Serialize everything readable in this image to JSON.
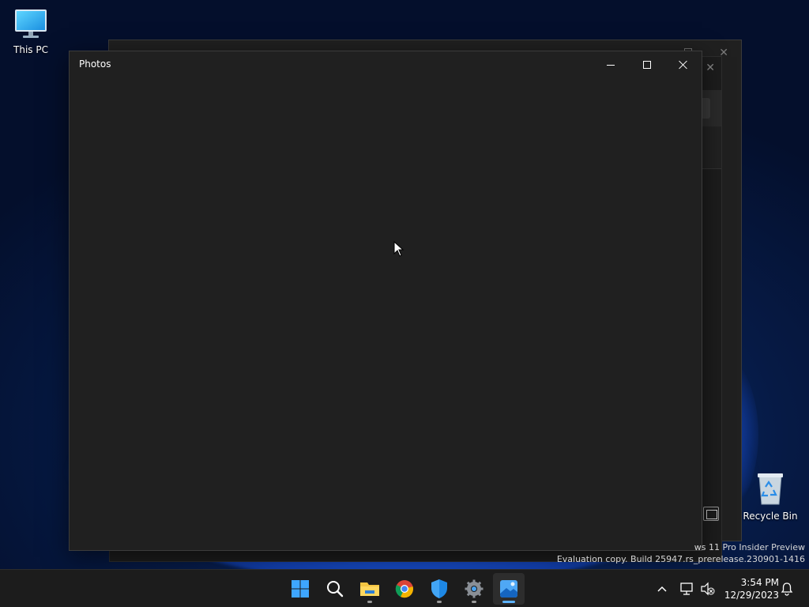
{
  "desktop": {
    "icons": [
      {
        "label": "This PC",
        "icon": "computer-monitor-icon"
      },
      {
        "label": "Recycle Bin",
        "icon": "recycle-bin-icon"
      }
    ],
    "watermark": {
      "line1": "ws 11 Pro Insider Preview",
      "line2": "Evaluation copy. Build 25947.rs_prerelease.230901-1416"
    }
  },
  "window": {
    "title": "Photos",
    "controls": {
      "minimize": "minimize-icon",
      "maximize": "maximize-icon",
      "close": "close-icon"
    }
  },
  "taskbar": {
    "apps": [
      {
        "name": "start",
        "icon": "windows-logo-icon"
      },
      {
        "name": "search",
        "icon": "search-icon"
      },
      {
        "name": "file-explorer",
        "icon": "folder-icon"
      },
      {
        "name": "chrome",
        "icon": "chrome-icon"
      },
      {
        "name": "security",
        "icon": "shield-icon"
      },
      {
        "name": "settings",
        "icon": "gear-icon"
      },
      {
        "name": "photos",
        "icon": "photos-icon",
        "active": true
      }
    ],
    "tray": {
      "time": "3:54 PM",
      "date": "12/29/2023"
    }
  },
  "colors": {
    "accent": "#5cb3ff",
    "window_bg": "#202020",
    "taskbar_bg": "#1c1c1c"
  }
}
